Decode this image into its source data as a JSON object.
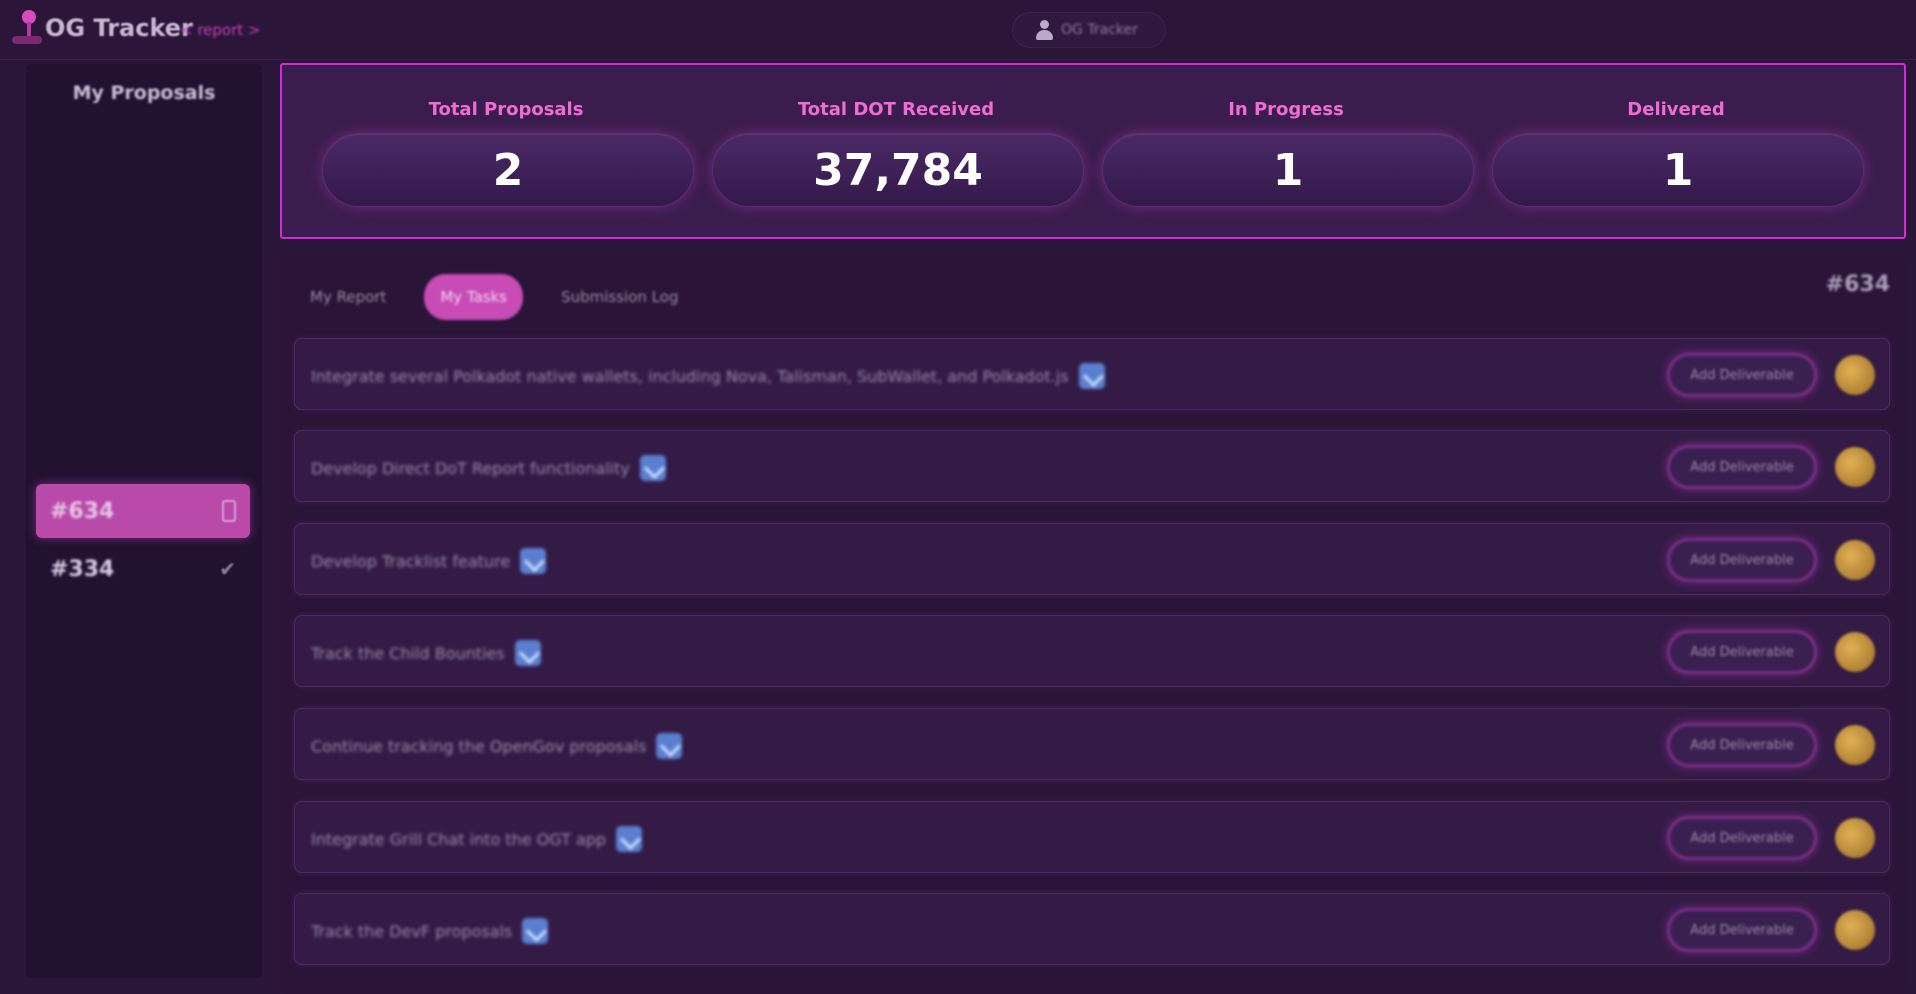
{
  "header": {
    "brand_title": "OG Tracker",
    "brand_sub": "< report >",
    "user_label": "OG Tracker"
  },
  "sidebar": {
    "title": "My Proposals",
    "items": [
      {
        "label": "#634",
        "status_icon": "clock-icon",
        "active": true
      },
      {
        "label": "#334",
        "status_icon": "check-icon",
        "active": false
      }
    ]
  },
  "stats": [
    {
      "label": "Total Proposals",
      "value": "2"
    },
    {
      "label": "Total DOT Received",
      "value": "37,784"
    },
    {
      "label": "In Progress",
      "value": "1"
    },
    {
      "label": "Delivered",
      "value": "1"
    }
  ],
  "main": {
    "tabs": [
      {
        "label": "My Report",
        "active": false
      },
      {
        "label": "My Tasks",
        "active": true
      },
      {
        "label": "Submission Log",
        "active": false
      }
    ],
    "proposal_id": "#634",
    "rows": [
      {
        "text": "Integrate several Polkadot native wallets, including Nova, Talisman, SubWallet, and Polkadot.js",
        "button": "Add Deliverable"
      },
      {
        "text": "Develop Direct DoT Report functionality",
        "button": "Add Deliverable"
      },
      {
        "text": "Develop Tracklist feature",
        "button": "Add Deliverable"
      },
      {
        "text": "Track the Child Bounties",
        "button": "Add Deliverable"
      },
      {
        "text": "Continue tracking the OpenGov proposals",
        "button": "Add Deliverable"
      },
      {
        "text": "Integrate Grill Chat into the OGT app",
        "button": "Add Deliverable"
      },
      {
        "text": "Track the DevF proposals",
        "button": "Add Deliverable"
      }
    ]
  },
  "colors": {
    "accent": "#d52ad8",
    "label_pink": "#ef6cd0",
    "background": "#2a1639"
  }
}
